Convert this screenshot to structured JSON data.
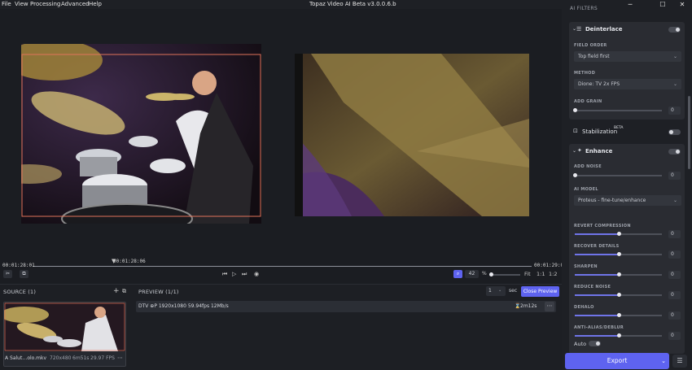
{
  "menu": [
    "File",
    "View",
    "Processing",
    "Advanced",
    "Help"
  ],
  "app_title": "Topaz Video AI Beta  v3.0.0.6.b",
  "window_controls": {
    "minimize": "─",
    "maximize": "☐",
    "close": "✕"
  },
  "timeline": {
    "start_time": "00:01:28:01",
    "playhead_time": "00:01:28:06",
    "end_time": "00:01:29:01",
    "zoom_value": "42",
    "zoom_unit": "%",
    "fit_label": "Fit",
    "ratio_1": "1:1",
    "ratio_2": "1:2"
  },
  "source": {
    "header": "SOURCE (1)",
    "add_icon": "+",
    "file_name": "A Salut…olo.mkv",
    "resolution": "720x480",
    "duration": "6m51s",
    "fps": "29.97 FPS",
    "more": "⋯"
  },
  "preview": {
    "header": "PREVIEW (1/1)",
    "count_value": "1",
    "count_unit": "sec",
    "close_label": "Close Preview",
    "row_text": "DTV  ⊕P 1920x1080 59.94fps 12Mb/s",
    "duration": "2m12s",
    "more": "⋯"
  },
  "sidebar": {
    "section_header": "AI FILTERS",
    "deinterlace": {
      "title": "Deinterlace",
      "field_order_label": "FIELD ORDER",
      "field_order_value": "Top field first",
      "method_label": "METHOD",
      "method_value": "Dione: TV 2x FPS",
      "add_grain_label": "ADD GRAIN",
      "add_grain_value": "0",
      "add_grain_level": 0
    },
    "stabilization": {
      "title": "Stabilization",
      "badge": "BETA"
    },
    "enhance": {
      "title": "Enhance",
      "add_noise_label": "ADD NOISE",
      "add_noise_value": "0",
      "add_noise_level": 0,
      "ai_model_label": "AI MODEL",
      "ai_model_value": "Proteus - fine-tune/enhance",
      "sliders": [
        {
          "label": "REVERT COMPRESSION",
          "value": "0",
          "level": 0.5
        },
        {
          "label": "RECOVER DETAILS",
          "value": "0",
          "level": 0.5
        },
        {
          "label": "SHARPEN",
          "value": "0",
          "level": 0.5
        },
        {
          "label": "REDUCE NOISE",
          "value": "0",
          "level": 0.5
        },
        {
          "label": "DEHALO",
          "value": "0",
          "level": 0.5
        },
        {
          "label": "ANTI-ALIAS/DEBLUR",
          "value": "0",
          "level": 0.5
        }
      ],
      "auto_label": "Auto"
    }
  },
  "export_label": "Export",
  "colors": {
    "accent": "#5e63f0",
    "background": "#1b1d22",
    "panel": "#2a2c32",
    "crop_frame": "#e0735a"
  }
}
